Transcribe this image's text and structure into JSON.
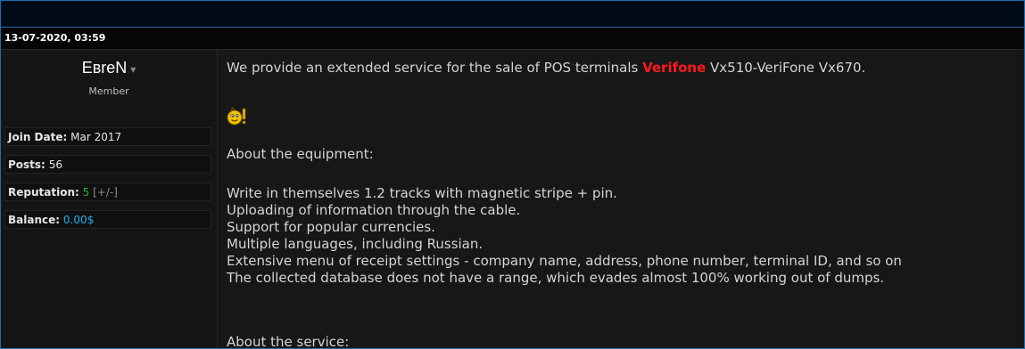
{
  "post": {
    "date": "13-07-2020, 03:59"
  },
  "user": {
    "name": "EвreN",
    "caret": "▾",
    "title": "Member",
    "stats": {
      "join_label": "Join Date:",
      "join_value": "Mar 2017",
      "posts_label": "Posts:",
      "posts_value": "56",
      "rep_label": "Reputation:",
      "rep_value": "5",
      "rep_toggle": "[+/-]",
      "balance_label": "Balance:",
      "balance_value": "0.00$"
    }
  },
  "message": {
    "intro_before": "We provide an extended service for the sale of POS terminals ",
    "intro_brand": "Verifone",
    "intro_after": " Vx510-VeriFone Vx670.",
    "smiley_icon": "thumbs-up-smiley-icon",
    "equipment_heading": "About the equipment:",
    "equipment_lines": [
      "Write in themselves 1.2 tracks with magnetic stripe + pin.",
      "Uploading of information through the cable.",
      "Support for popular currencies.",
      "Multiple languages, including Russian.",
      "Extensive menu of receipt settings - company name, address, phone number, terminal ID, and so on",
      "The collected database does not have a range, which evades almost 100% working out of dumps."
    ],
    "service_heading": "About the service:"
  },
  "colors": {
    "brand": "#ff1a1a",
    "reputation": "#2ab52a",
    "balance": "#22aef0",
    "frame_border": "#1a6fb0"
  }
}
